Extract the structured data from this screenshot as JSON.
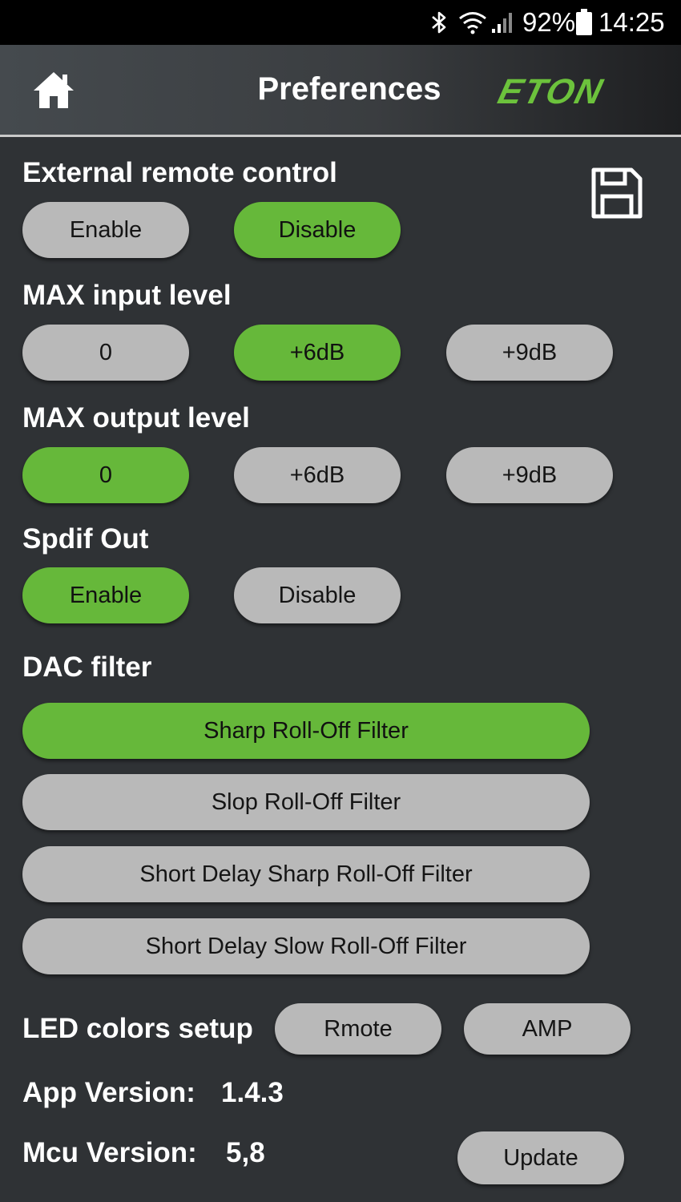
{
  "status_bar": {
    "battery_percent": "92%",
    "time": "14:25",
    "icons": [
      "bluetooth-icon",
      "wifi-icon",
      "signal-icon",
      "battery-icon"
    ]
  },
  "header": {
    "title": "Preferences",
    "logo_text": "ETON",
    "icons": [
      "home-icon"
    ]
  },
  "colors": {
    "active": "#66b83a",
    "inactive": "#b9b9b9",
    "background": "#2f3235"
  },
  "external_remote": {
    "title": "External remote control",
    "enable_label": "Enable",
    "disable_label": "Disable",
    "selected": "Disable",
    "save_icon": "save-icon"
  },
  "max_input": {
    "title": "MAX input level",
    "options": [
      "0",
      "+6dB",
      "+9dB"
    ],
    "selected": "+6dB"
  },
  "max_output": {
    "title": "MAX output level",
    "options": [
      "0",
      "+6dB",
      "+9dB"
    ],
    "selected": "0"
  },
  "spdif": {
    "title": "Spdif Out",
    "enable_label": "Enable",
    "disable_label": "Disable",
    "selected": "Enable"
  },
  "dac_filter": {
    "title": "DAC filter",
    "options": [
      "Sharp Roll-Off Filter",
      "Slop Roll-Off Filter",
      "Short Delay Sharp Roll-Off Filter",
      "Short Delay Slow Roll-Off Filter"
    ],
    "selected": "Sharp Roll-Off Filter"
  },
  "led": {
    "title": "LED colors setup",
    "remote_label": "Rmote",
    "amp_label": "AMP"
  },
  "versions": {
    "app_label": "App Version:",
    "app_value": "1.4.3",
    "mcu_label": "Mcu Version:",
    "mcu_value": "5,8",
    "update_label": "Update"
  }
}
